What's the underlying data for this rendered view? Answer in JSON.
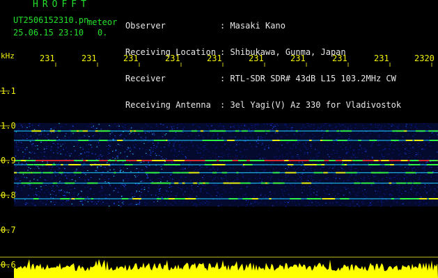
{
  "header": {
    "logo": "HROFFT",
    "filename": "UT2506152310.pn",
    "meteor_label": "meteor",
    "datetime": "25.06.15 23:10",
    "counter": "0.",
    "info": [
      {
        "label": "Observer",
        "value": "Masaki Kano"
      },
      {
        "label": "Receiving Location",
        "value": "Shibukawa, Gunma, Japan"
      },
      {
        "label": "Receiver",
        "value": "RTL-SDR SDR# 43dB L15 103.2MHz CW"
      },
      {
        "label": "Receiving Antenna",
        "value": "3el Yagi(V) Az 330 for Vladivostok"
      }
    ]
  },
  "axis": {
    "unit": "kHz",
    "time_ticks": [
      "231",
      "231",
      "231",
      "231",
      "231",
      "231",
      "231",
      "231",
      "231",
      "2320"
    ],
    "freq_ticks": [
      "1.1",
      "1.0",
      "0.9",
      "0.8",
      "0.7",
      "0.6"
    ]
  },
  "chart_data": {
    "type": "heatmap",
    "ylabel": "kHz",
    "ylim": [
      0.6,
      1.15
    ],
    "x_tick_labels": [
      "231",
      "231",
      "231",
      "231",
      "231",
      "231",
      "231",
      "231",
      "231",
      "2320"
    ],
    "y_tick_labels": [
      "1.1",
      "1.0",
      "0.9",
      "0.8",
      "0.7",
      "0.6"
    ],
    "signal_band_khz": [
      0.78,
      1.0
    ],
    "bright_lines_khz": [
      0.985,
      0.958,
      0.9,
      0.888,
      0.865,
      0.835,
      0.79
    ],
    "strongest_line_khz": 0.9,
    "palette": [
      "#000000",
      "#0a1a8c",
      "#1e50ff",
      "#20d0ff",
      "#30ff40",
      "#ffff00",
      "#ff3030"
    ],
    "level_meter_color": "#ffff00"
  },
  "colors": {
    "text_green": "#22e02a",
    "text_white": "#e8e8e8",
    "text_yellow": "#f2f20a",
    "background": "#000000"
  }
}
